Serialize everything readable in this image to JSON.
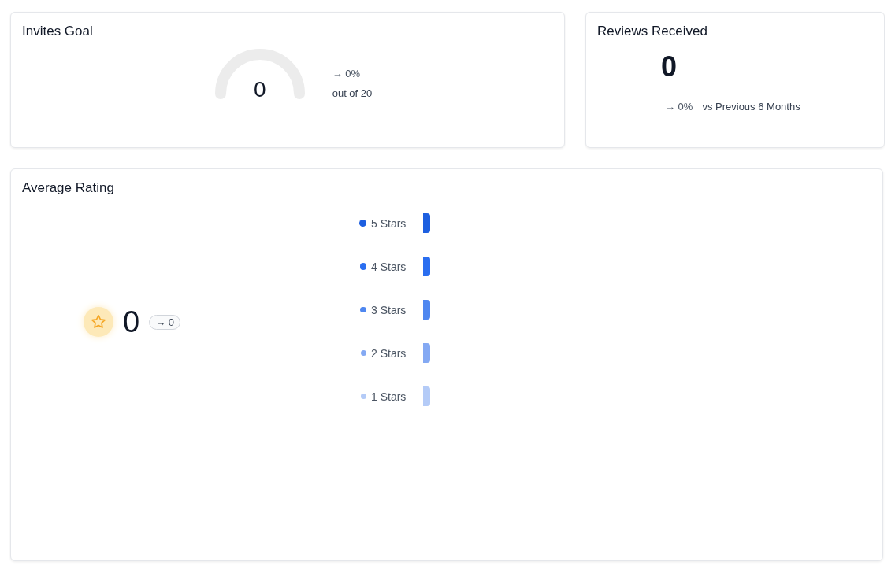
{
  "invites_goal": {
    "title": "Invites Goal",
    "gauge": {
      "value": "0"
    },
    "change": "→ 0%",
    "target": "out of 20"
  },
  "reviews_received": {
    "title": "Reviews Received",
    "value": "0",
    "change": "→ 0%",
    "comparison": "vs Previous 6 Months"
  },
  "average_rating": {
    "title": "Average Rating",
    "value": "0",
    "change_badge": "→ 0",
    "distribution": [
      {
        "label": "5 Stars",
        "color": "#1d5fe0"
      },
      {
        "label": "4 Stars",
        "color": "#2a6ef0"
      },
      {
        "label": "3 Stars",
        "color": "#4f87f0"
      },
      {
        "label": "2 Stars",
        "color": "#84a9f3"
      },
      {
        "label": "1 Stars",
        "color": "#b4cbf7"
      }
    ]
  }
}
